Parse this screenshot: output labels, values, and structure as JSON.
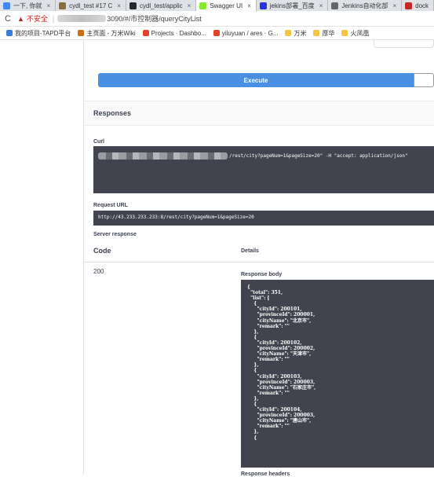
{
  "browser": {
    "tabs": [
      {
        "label": "一下, 你就",
        "color": "#4285f4",
        "active": false
      },
      {
        "label": "cydl_test #17 C",
        "color": "#8a6d3b",
        "active": false
      },
      {
        "label": "cydl_test/applic",
        "color": "#24292e",
        "active": false
      },
      {
        "label": "Swagger UI",
        "color": "#85ea2d",
        "active": true
      },
      {
        "label": "jekins部署_百度",
        "color": "#2932e1",
        "active": false
      },
      {
        "label": "Jenkins自动化部",
        "color": "#666666",
        "active": false
      },
      {
        "label": "dock",
        "color": "#c62828",
        "active": false
      }
    ],
    "tab_close": "×",
    "reload_icon": "C",
    "security_warning": "不安全",
    "url": "3090/#/市控制器/queryCityList",
    "bookmarks": [
      {
        "label": "我的项目-TAPD平台",
        "color": "#3b7ddd"
      },
      {
        "label": "主页面 - 万米Wiki",
        "color": "#c9701a"
      },
      {
        "label": "Projects · Dashbo...",
        "color": "#e24329"
      },
      {
        "label": "yiluyuan / ares · G...",
        "color": "#e24329"
      },
      {
        "label": "万米",
        "color": "#f4c542"
      },
      {
        "label": "厚华",
        "color": "#f4c542"
      },
      {
        "label": "火凤凰",
        "color": "#f4c542"
      }
    ]
  },
  "swagger": {
    "execute_label": "Execute",
    "responses_title": "Responses",
    "curl_label": "Curl",
    "curl_command": "/rest/city?pageNum=1&pageSize=20\" -H \"accept: application/json\"",
    "request_url_label": "Request URL",
    "request_url": "http://43.233.233.233:8/rest/city?pageNum=1&pageSize=20",
    "server_response_label": "Server response",
    "col_code": "Code",
    "col_details": "Details",
    "response_code": "200",
    "response_body_label": "Response body",
    "response_body": "{\n  \"total\": 351,\n  \"list\": [\n    {\n      \"cityId\": 200101,\n      \"provinceId\": 200001,\n      \"cityName\": \"北京市\",\n      \"remark\": \"\"\n    },\n    {\n      \"cityId\": 200102,\n      \"provinceId\": 200002,\n      \"cityName\": \"天津市\",\n      \"remark\": \"\"\n    },\n    {\n      \"cityId\": 200103,\n      \"provinceId\": 200003,\n      \"cityName\": \"石家庄市\",\n      \"remark\": \"\"\n    },\n    {\n      \"cityId\": 200104,\n      \"provinceId\": 200003,\n      \"cityName\": \"唐山市\",\n      \"remark\": \"\"\n    },\n    {",
    "response_headers_label": "Response headers"
  }
}
